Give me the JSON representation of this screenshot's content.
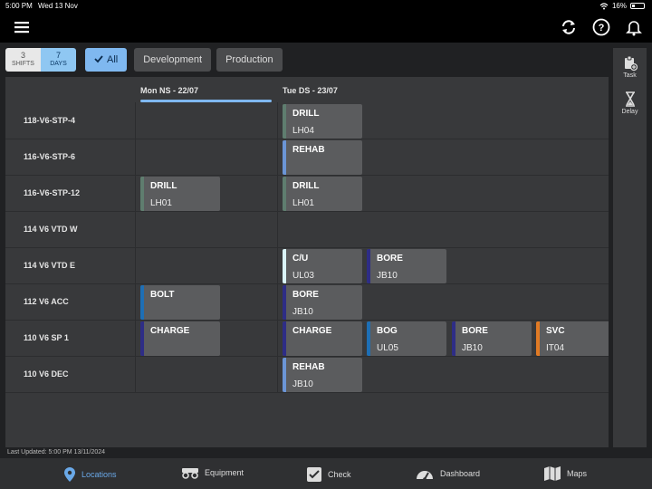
{
  "status": {
    "time": "5:00 PM",
    "date": "Wed 13 Nov",
    "battery": "16%"
  },
  "toolbar": {
    "menu_icon": "menu-icon",
    "refresh_icon": "refresh-icon",
    "help_icon": "help-icon",
    "bell_icon": "bell-icon"
  },
  "filters": {
    "shifts_count": "3",
    "shifts_label": "SHIFTS",
    "days_count": "7",
    "days_label": "DAYS",
    "all_label": "All",
    "development_label": "Development",
    "production_label": "Production"
  },
  "days": [
    {
      "label": "Mon NS - 22/07"
    },
    {
      "label": "Tue DS - 23/07"
    }
  ],
  "rows": [
    {
      "label": "118-V6-STP-4"
    },
    {
      "label": "116-V6-STP-6"
    },
    {
      "label": "116-V6-STP-12"
    },
    {
      "label": "114 V6 VTD W"
    },
    {
      "label": "114 V6 VTD E"
    },
    {
      "label": "112 V6 ACC"
    },
    {
      "label": "110 V6 SP 1"
    },
    {
      "label": "110 V6 DEC"
    }
  ],
  "tasks": [
    {
      "row": 0,
      "col": "t1",
      "title": "DRILL",
      "code": "LH04",
      "color": "#5f7d6f"
    },
    {
      "row": 1,
      "col": "t1",
      "title": "REHAB",
      "code": "",
      "color": "#6b95d6"
    },
    {
      "row": 2,
      "col": "m",
      "title": "DRILL",
      "code": "LH01",
      "color": "#5f7d6f"
    },
    {
      "row": 2,
      "col": "t1",
      "title": "DRILL",
      "code": "LH01",
      "color": "#5f7d6f"
    },
    {
      "row": 4,
      "col": "t1",
      "title": "C/U",
      "code": "UL03",
      "color": "#d9f3f7"
    },
    {
      "row": 4,
      "col": "t2",
      "title": "BORE",
      "code": "JB10",
      "color": "#2e2d86"
    },
    {
      "row": 5,
      "col": "m",
      "title": "BOLT",
      "code": "",
      "color": "#1e6fb5"
    },
    {
      "row": 5,
      "col": "t1",
      "title": "BORE",
      "code": "JB10",
      "color": "#2e2d86"
    },
    {
      "row": 6,
      "col": "m",
      "title": "CHARGE",
      "code": "",
      "color": "#2e2d86"
    },
    {
      "row": 6,
      "col": "t1",
      "title": "CHARGE",
      "code": "",
      "color": "#2e2d86"
    },
    {
      "row": 6,
      "col": "t2",
      "title": "BOG",
      "code": "UL05",
      "color": "#1e6fb5"
    },
    {
      "row": 6,
      "col": "t3",
      "title": "BORE",
      "code": "JB10",
      "color": "#2e2d86"
    },
    {
      "row": 6,
      "col": "t4",
      "title": "SVC",
      "code": "IT04",
      "color": "#e07a24"
    },
    {
      "row": 7,
      "col": "t1",
      "title": "REHAB",
      "code": "JB10",
      "color": "#6b95d6"
    }
  ],
  "side_actions": {
    "task_label": "Task",
    "delay_label": "Delay"
  },
  "footer": {
    "last_updated": "Last Updated: 5:00 PM 13/11/2024"
  },
  "tabs": {
    "locations": "Locations",
    "equipment": "Equipment",
    "check": "Check",
    "dashboard": "Dashboard",
    "maps": "Maps"
  }
}
